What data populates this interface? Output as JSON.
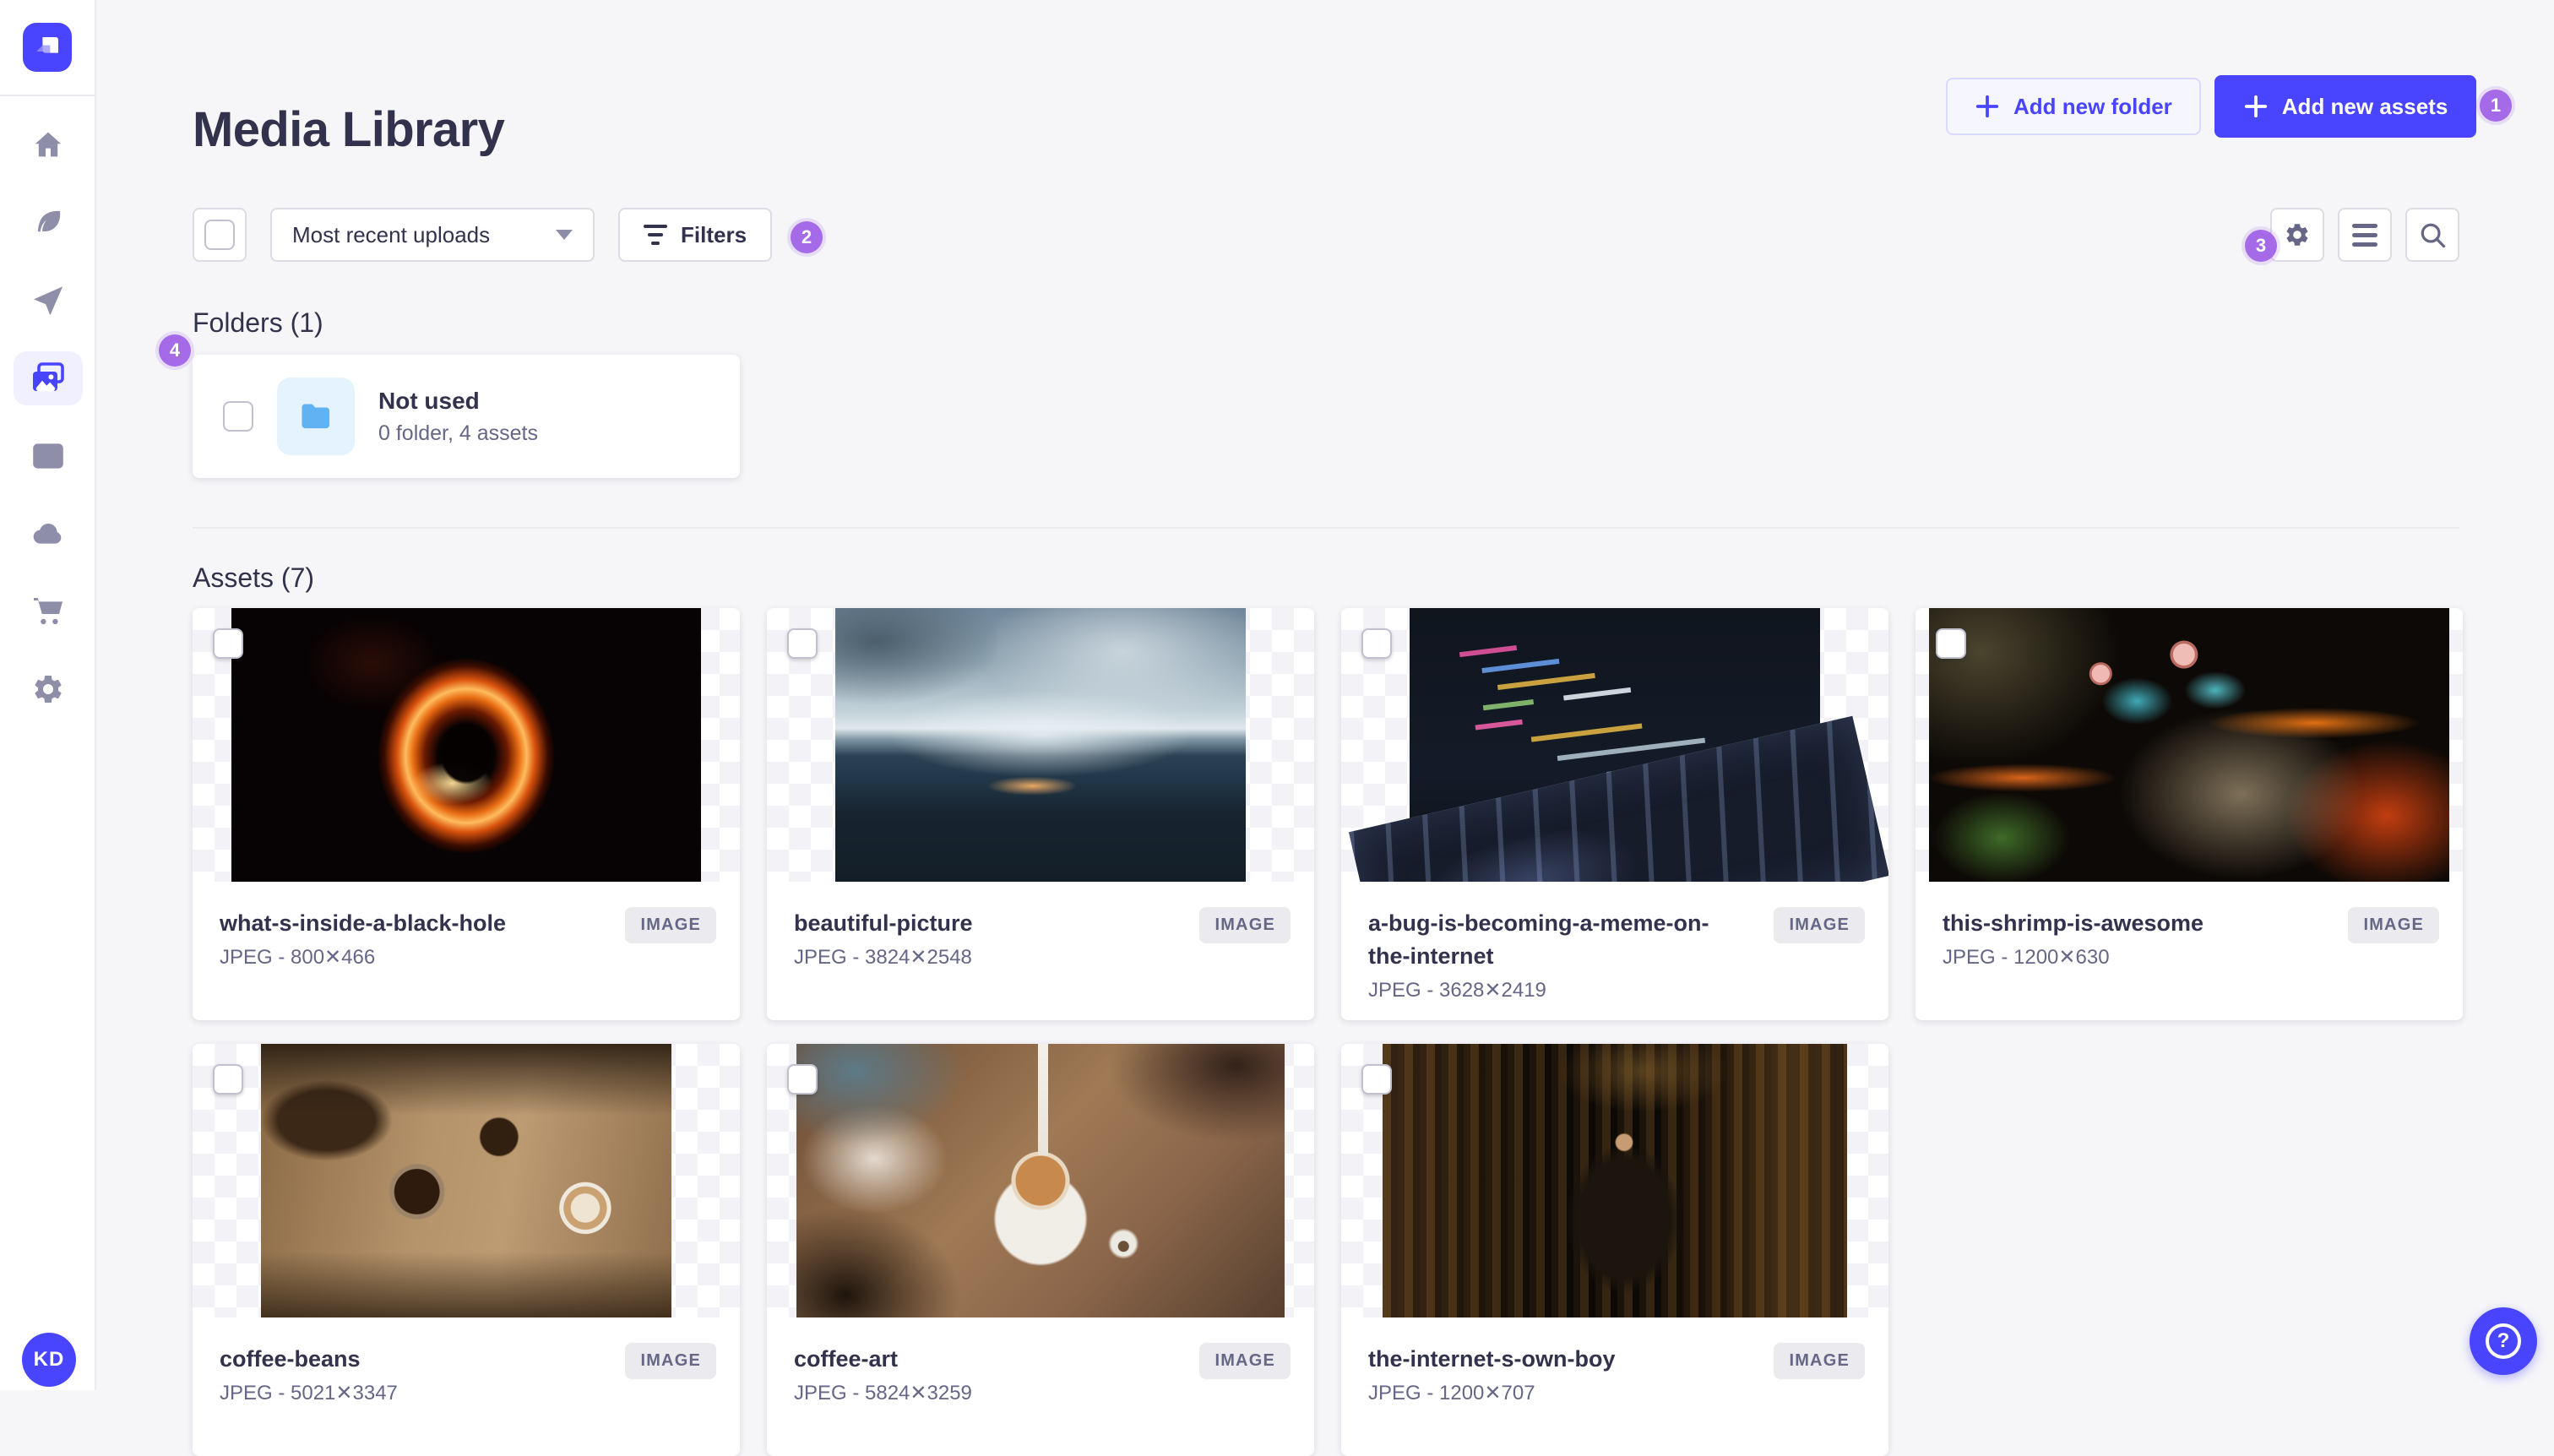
{
  "header": {
    "title": "Media Library",
    "add_folder_label": "Add new folder",
    "add_assets_label": "Add new assets"
  },
  "toolbar": {
    "sort_value": "Most recent uploads",
    "filters_label": "Filters"
  },
  "tour_badges": {
    "add_assets": "1",
    "filters": "2",
    "settings": "3",
    "folders": "4"
  },
  "sidebar": {
    "avatar_initials": "KD",
    "icons": [
      "strapi-logo-icon",
      "home-icon",
      "feather-icon",
      "paper-plane-icon",
      "media-library-icon",
      "layout-icon",
      "cloud-icon",
      "cart-icon",
      "settings-icon"
    ]
  },
  "folders": {
    "heading": "Folders (1)",
    "items": [
      {
        "name": "Not used",
        "meta": "0 folder, 4 assets"
      }
    ]
  },
  "assets": {
    "heading": "Assets (7)",
    "type_badge": "IMAGE",
    "items": [
      {
        "name": "what-s-inside-a-black-hole",
        "meta": "JPEG - 800✕466",
        "thumb": "black-hole"
      },
      {
        "name": "beautiful-picture",
        "meta": "JPEG - 3824✕2548",
        "thumb": "mountains"
      },
      {
        "name": "a-bug-is-becoming-a-meme-on-the-internet",
        "meta": "JPEG - 3628✕2419",
        "thumb": "laptop-code"
      },
      {
        "name": "this-shrimp-is-awesome",
        "meta": "JPEG - 1200✕630",
        "thumb": "mantis-shrimp"
      },
      {
        "name": "coffee-beans",
        "meta": "JPEG - 5021✕3347",
        "thumb": "coffee-beans"
      },
      {
        "name": "coffee-art",
        "meta": "JPEG - 5824✕3259",
        "thumb": "coffee-art"
      },
      {
        "name": "the-internet-s-own-boy",
        "meta": "JPEG - 1200✕707",
        "thumb": "library-boy"
      }
    ]
  },
  "help": {
    "icon": "?"
  },
  "colors": {
    "accent": "#4945ff",
    "tour_badge_purple": "#a56ae8",
    "background": "#f6f6f9",
    "folder_blue": "#61b2f2",
    "text_dark": "#32324d",
    "text_muted": "#666687"
  }
}
